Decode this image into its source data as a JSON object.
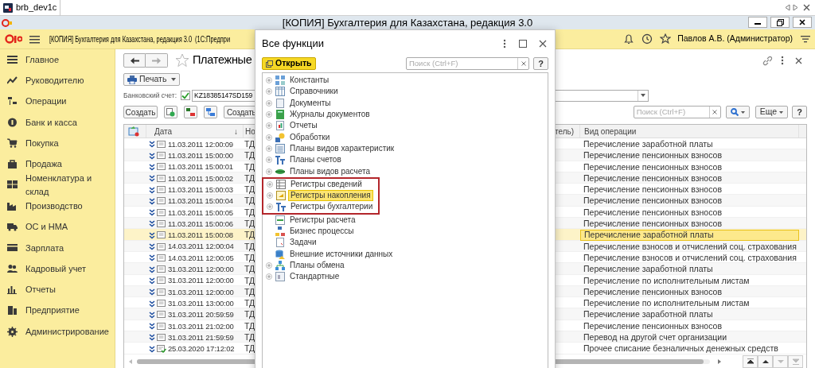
{
  "browser_tab": {
    "title": "brb_dev1c"
  },
  "window": {
    "title": "[КОПИЯ] Бухгалтерия для Казахстана, редакция 3.0"
  },
  "app_bar": {
    "title": "[КОПИЯ] Бухгалтерия для Казахстана, редакция 3.0  (1С:Предпри",
    "user": "Павлов А.В. (Администратор)"
  },
  "sidebar": {
    "items": [
      {
        "label": "Главное",
        "kind": "lines"
      },
      {
        "label": "Руководителю",
        "kind": "trend"
      },
      {
        "label": "Операции",
        "kind": "ledger"
      },
      {
        "label": "Банк и касса",
        "kind": "coin"
      },
      {
        "label": "Покупка",
        "kind": "cart"
      },
      {
        "label": "Продажа",
        "kind": "bag"
      },
      {
        "label": "Номенклатура и склад",
        "kind": "grid"
      },
      {
        "label": "Производство",
        "kind": "factory"
      },
      {
        "label": "ОС и НМА",
        "kind": "truck"
      },
      {
        "label": "Зарплата",
        "kind": "card"
      },
      {
        "label": "Кадровый учет",
        "kind": "people"
      },
      {
        "label": "Отчеты",
        "kind": "bars"
      },
      {
        "label": "Предприятие",
        "kind": "building"
      },
      {
        "label": "Администрирование",
        "kind": "gear"
      }
    ]
  },
  "form": {
    "title": "Платежные",
    "print_button": "Печать",
    "bank_account": {
      "label": "Банковский счет:",
      "checked": true,
      "value": "KZ18385147SD159"
    },
    "toolbar": {
      "create_button": "Создать",
      "create_button_2": "Создать",
      "search_placeholder": "Поиск (Ctrl+F)",
      "more_button": "Еще",
      "help_button": "?"
    },
    "table": {
      "columns": [
        {
          "label": "Дата",
          "sort": "↓"
        },
        {
          "label": "Но"
        },
        {
          "label": "тель)"
        },
        {
          "label": "Вид операции"
        }
      ],
      "rows": [
        {
          "kind": "document",
          "date": "11.03.2011 12:00:09",
          "number": "ТД",
          "operation": "Перечисление заработной платы",
          "selected": false
        },
        {
          "kind": "document",
          "date": "11.03.2011 15:00:00",
          "number": "ТД",
          "operation": "Перечисление пенсионных взносов",
          "selected": false
        },
        {
          "kind": "document",
          "date": "11.03.2011 15:00:01",
          "number": "ТД",
          "operation": "Перечисление пенсионных взносов",
          "selected": false
        },
        {
          "kind": "document",
          "date": "11.03.2011 15:00:02",
          "number": "ТД",
          "operation": "Перечисление пенсионных взносов",
          "selected": false
        },
        {
          "kind": "document",
          "date": "11.03.2011 15:00:03",
          "number": "ТД",
          "operation": "Перечисление пенсионных взносов",
          "selected": false
        },
        {
          "kind": "document",
          "date": "11.03.2011 15:00:04",
          "number": "ТД",
          "operation": "Перечисление пенсионных взносов",
          "selected": false
        },
        {
          "kind": "document",
          "date": "11.03.2011 15:00:05",
          "number": "ТД",
          "operation": "Перечисление пенсионных взносов",
          "selected": false
        },
        {
          "kind": "document",
          "date": "11.03.2011 15:00:06",
          "number": "ТД",
          "operation": "Перечисление пенсионных взносов",
          "selected": false
        },
        {
          "kind": "document",
          "date": "11.03.2011 15:00:08",
          "number": "ТД",
          "operation": "Перечисление заработной платы",
          "selected": true
        },
        {
          "kind": "document",
          "date": "14.03.2011 12:00:04",
          "number": "ТД",
          "operation": "Перечисление взносов и отчислений соц. страхования",
          "selected": false
        },
        {
          "kind": "document",
          "date": "14.03.2011 12:00:05",
          "number": "ТД",
          "operation": "Перечисление взносов и отчислений соц. страхования",
          "selected": false
        },
        {
          "kind": "document",
          "date": "31.03.2011 12:00:00",
          "number": "ТД",
          "operation": "Перечисление заработной платы",
          "selected": false
        },
        {
          "kind": "document",
          "date": "31.03.2011 12:00:00",
          "number": "ТД",
          "operation": "Перечисление по исполнительным листам",
          "selected": false
        },
        {
          "kind": "document",
          "date": "31.03.2011 12:00:00",
          "number": "ТД",
          "operation": "Перечисление пенсионных взносов",
          "selected": false
        },
        {
          "kind": "document",
          "date": "31.03.2011 13:00:00",
          "number": "ТД",
          "operation": "Перечисление по исполнительным листам",
          "selected": false
        },
        {
          "kind": "document",
          "date": "31.03.2011 20:59:59",
          "number": "ТД",
          "operation": "Перечисление заработной платы",
          "selected": false
        },
        {
          "kind": "document",
          "date": "31.03.2011 21:02:00",
          "number": "ТД",
          "operation": "Перечисление пенсионных взносов",
          "selected": false
        },
        {
          "kind": "document",
          "date": "31.03.2011 21:59:59",
          "number": "ТД",
          "operation": "Перевод на другой счет организации",
          "selected": false
        },
        {
          "kind": "document-posted",
          "date": "25.03.2020 17:12:02",
          "number": "ТД",
          "operation": "Прочее списание безналичных денежных средств",
          "selected": false
        }
      ]
    }
  },
  "dialog": {
    "title": "Все функции",
    "open_button": "Открыть",
    "search_placeholder": "Поиск (Ctrl+F)",
    "help_button": "?",
    "items": [
      {
        "label": "Константы",
        "kind": "constants",
        "expandable": true,
        "selected": false,
        "framed": false
      },
      {
        "label": "Справочники",
        "kind": "catalogs",
        "expandable": true,
        "selected": false,
        "framed": false
      },
      {
        "label": "Документы",
        "kind": "documents",
        "expandable": true,
        "selected": false,
        "framed": false
      },
      {
        "label": "Журналы документов",
        "kind": "journals",
        "expandable": true,
        "selected": false,
        "framed": false
      },
      {
        "label": "Отчеты",
        "kind": "reports",
        "expandable": true,
        "selected": false,
        "framed": false
      },
      {
        "label": "Обработки",
        "kind": "processors",
        "expandable": true,
        "selected": false,
        "framed": false
      },
      {
        "label": "Планы видов характеристик",
        "kind": "characteristics",
        "expandable": true,
        "selected": false,
        "framed": false
      },
      {
        "label": "Планы счетов",
        "kind": "accounts",
        "expandable": true,
        "selected": false,
        "framed": false
      },
      {
        "label": "Планы видов расчета",
        "kind": "calculation",
        "expandable": true,
        "selected": false,
        "framed": false
      },
      {
        "label": "Регистры сведений",
        "kind": "info-registers",
        "expandable": true,
        "selected": false,
        "framed": true
      },
      {
        "label": "Регистры накопления",
        "kind": "accum-registers",
        "expandable": true,
        "selected": true,
        "framed": true
      },
      {
        "label": "Регистры бухгалтерии",
        "kind": "accounts",
        "expandable": true,
        "selected": false,
        "framed": true
      },
      {
        "label": "Регистры расчета",
        "kind": "calc-registers",
        "expandable": false,
        "selected": false,
        "framed": false
      },
      {
        "label": "Бизнес процессы",
        "kind": "business",
        "expandable": false,
        "selected": false,
        "framed": false
      },
      {
        "label": "Задачи",
        "kind": "tasks",
        "expandable": false,
        "selected": false,
        "framed": false
      },
      {
        "label": "Внешние источники данных",
        "kind": "external",
        "expandable": false,
        "selected": false,
        "framed": false
      },
      {
        "label": "Планы обмена",
        "kind": "exchange",
        "expandable": true,
        "selected": false,
        "framed": false
      },
      {
        "label": "Стандартные",
        "kind": "standard",
        "expandable": true,
        "selected": false,
        "framed": false
      }
    ]
  }
}
